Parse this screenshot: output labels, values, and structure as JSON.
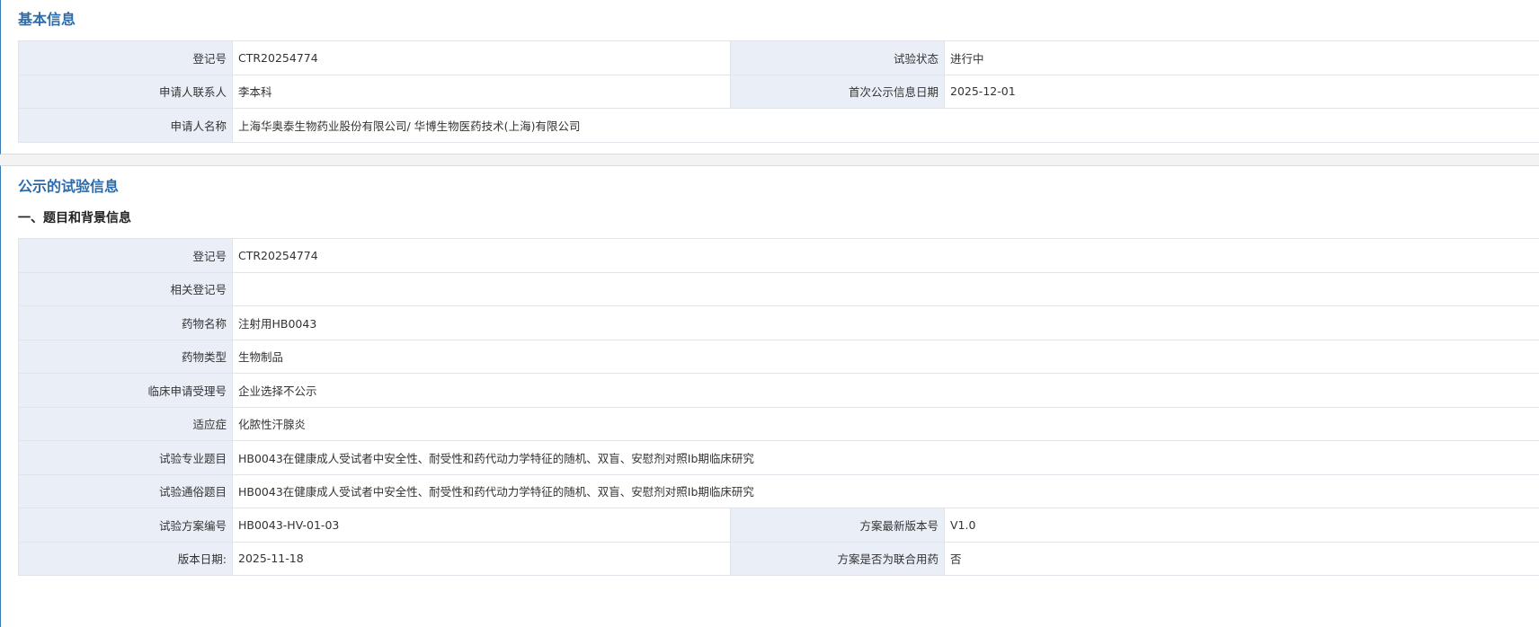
{
  "basic": {
    "title": "基本信息",
    "rows": [
      {
        "label1": "登记号",
        "value1": "CTR20254774",
        "label2": "试验状态",
        "value2": "进行中"
      },
      {
        "label1": "申请人联系人",
        "value1": "李本科",
        "label2": "首次公示信息日期",
        "value2": "2025-12-01"
      },
      {
        "label1": "申请人名称",
        "value1": "上海华奥泰生物药业股份有限公司/ 华博生物医药技术(上海)有限公司"
      }
    ]
  },
  "public": {
    "title": "公示的试验信息",
    "subtitle": "一、题目和背景信息",
    "rows": [
      {
        "label1": "登记号",
        "value1": "CTR20254774"
      },
      {
        "label1": "相关登记号",
        "value1": ""
      },
      {
        "label1": "药物名称",
        "value1": "注射用HB0043"
      },
      {
        "label1": "药物类型",
        "value1": "生物制品"
      },
      {
        "label1": "临床申请受理号",
        "value1": "企业选择不公示"
      },
      {
        "label1": "适应症",
        "value1": "化脓性汗腺炎"
      },
      {
        "label1": "试验专业题目",
        "value1": "HB0043在健康成人受试者中安全性、耐受性和药代动力学特征的随机、双盲、安慰剂对照Ib期临床研究"
      },
      {
        "label1": "试验通俗题目",
        "value1": "HB0043在健康成人受试者中安全性、耐受性和药代动力学特征的随机、双盲、安慰剂对照Ib期临床研究"
      },
      {
        "label1": "试验方案编号",
        "value1": "HB0043-HV-01-03",
        "label2": "方案最新版本号",
        "value2": "V1.0"
      },
      {
        "label1": "版本日期:",
        "value1": "2025-11-18",
        "label2": "方案是否为联合用药",
        "value2": "否"
      }
    ]
  }
}
